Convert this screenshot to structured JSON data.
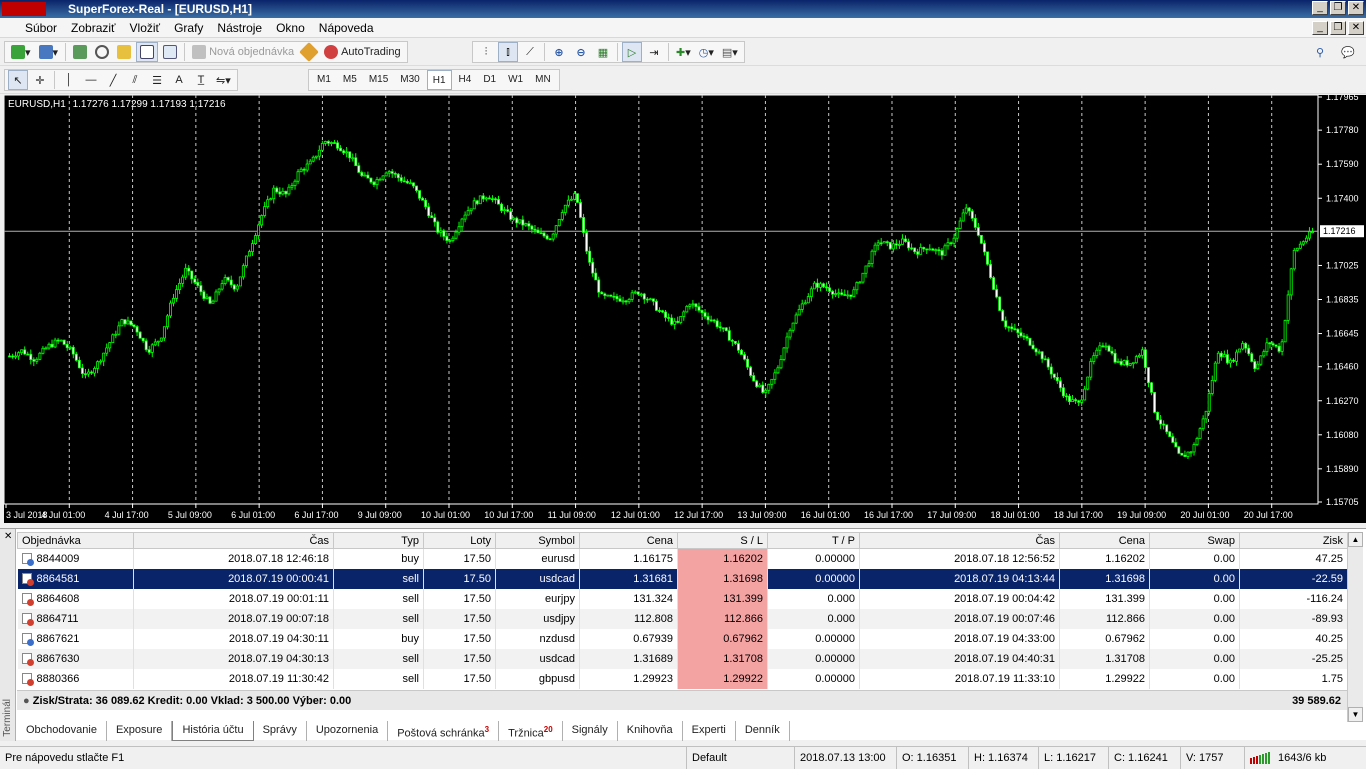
{
  "window": {
    "title": "SuperForex-Real - [EURUSD,H1]"
  },
  "menu": {
    "items": [
      "Súbor",
      "Zobraziť",
      "Vložiť",
      "Grafy",
      "Nástroje",
      "Okno",
      "Nápoveda"
    ]
  },
  "toolbar": {
    "new_order_label": "Nová objednávka",
    "autotrading_label": "AutoTrading"
  },
  "timeframes": {
    "items": [
      "M1",
      "M5",
      "M15",
      "M30",
      "H1",
      "H4",
      "D1",
      "W1",
      "MN"
    ],
    "active": "H1"
  },
  "chart_data": {
    "type": "candlestick",
    "title": "EURUSD,H1  1.17276 1.17299 1.17193 1.17216",
    "symbol": "EURUSD,H1",
    "ohlc_header": "1.17276 1.17299 1.17193 1.17216",
    "y_ticks": [
      "1.17965",
      "1.17780",
      "1.17590",
      "1.17400",
      "1.17216",
      "1.17025",
      "1.16835",
      "1.16645",
      "1.16460",
      "1.16270",
      "1.16080",
      "1.15890",
      "1.15705"
    ],
    "y_tick_values": [
      1.17965,
      1.1778,
      1.1759,
      1.174,
      1.17216,
      1.17025,
      1.16835,
      1.16645,
      1.1646,
      1.1627,
      1.1608,
      1.1589,
      1.15705
    ],
    "ylim": [
      1.15705,
      1.17965
    ],
    "current_price": 1.17216,
    "current_price_label": "1.17216",
    "x_ticks": [
      "3 Jul 2018",
      "4 Jul 01:00",
      "4 Jul 17:00",
      "5 Jul 09:00",
      "6 Jul 01:00",
      "6 Jul 17:00",
      "9 Jul 09:00",
      "10 Jul 01:00",
      "10 Jul 17:00",
      "11 Jul 09:00",
      "12 Jul 01:00",
      "12 Jul 17:00",
      "13 Jul 09:00",
      "16 Jul 01:00",
      "16 Jul 17:00",
      "17 Jul 09:00",
      "18 Jul 01:00",
      "18 Jul 17:00",
      "19 Jul 09:00",
      "20 Jul 01:00",
      "20 Jul 17:00"
    ],
    "close_path": [
      [
        0,
        1.1652
      ],
      [
        2,
        1.1655
      ],
      [
        4,
        1.165
      ],
      [
        6,
        1.1657
      ],
      [
        8,
        1.1661
      ],
      [
        10,
        1.1654
      ],
      [
        12,
        1.164
      ],
      [
        14,
        1.1648
      ],
      [
        16,
        1.166
      ],
      [
        18,
        1.1672
      ],
      [
        20,
        1.1668
      ],
      [
        22,
        1.1655
      ],
      [
        24,
        1.1662
      ],
      [
        26,
        1.1685
      ],
      [
        28,
        1.17
      ],
      [
        30,
        1.169
      ],
      [
        32,
        1.168
      ],
      [
        34,
        1.1695
      ],
      [
        36,
        1.169
      ],
      [
        38,
        1.171
      ],
      [
        40,
        1.173
      ],
      [
        42,
        1.1745
      ],
      [
        44,
        1.1742
      ],
      [
        46,
        1.1755
      ],
      [
        48,
        1.176
      ],
      [
        50,
        1.1772
      ],
      [
        52,
        1.177
      ],
      [
        54,
        1.1764
      ],
      [
        56,
        1.1752
      ],
      [
        58,
        1.1749
      ],
      [
        60,
        1.1756
      ],
      [
        62,
        1.1751
      ],
      [
        64,
        1.1747
      ],
      [
        66,
        1.1736
      ],
      [
        68,
        1.1722
      ],
      [
        70,
        1.1716
      ],
      [
        72,
        1.173
      ],
      [
        74,
        1.1738
      ],
      [
        76,
        1.1742
      ],
      [
        78,
        1.1735
      ],
      [
        80,
        1.1728
      ],
      [
        82,
        1.1725
      ],
      [
        84,
        1.172
      ],
      [
        86,
        1.1718
      ],
      [
        88,
        1.1735
      ],
      [
        90,
        1.1742
      ],
      [
        92,
        1.1705
      ],
      [
        94,
        1.1685
      ],
      [
        96,
        1.1684
      ],
      [
        98,
        1.1684
      ],
      [
        100,
        1.1688
      ],
      [
        102,
        1.1682
      ],
      [
        104,
        1.1674
      ],
      [
        106,
        1.1669
      ],
      [
        108,
        1.1682
      ],
      [
        110,
        1.1676
      ],
      [
        112,
        1.1671
      ],
      [
        114,
        1.1664
      ],
      [
        116,
        1.1655
      ],
      [
        118,
        1.164
      ],
      [
        120,
        1.163
      ],
      [
        122,
        1.1645
      ],
      [
        124,
        1.1668
      ],
      [
        126,
        1.1681
      ],
      [
        128,
        1.1692
      ],
      [
        130,
        1.169
      ],
      [
        132,
        1.1685
      ],
      [
        134,
        1.1687
      ],
      [
        136,
        1.1701
      ],
      [
        138,
        1.1716
      ],
      [
        140,
        1.1713
      ],
      [
        142,
        1.1716
      ],
      [
        144,
        1.171
      ],
      [
        146,
        1.1713
      ],
      [
        148,
        1.1709
      ],
      [
        150,
        1.1718
      ],
      [
        152,
        1.1735
      ],
      [
        154,
        1.172
      ],
      [
        156,
        1.1695
      ],
      [
        158,
        1.167
      ],
      [
        160,
        1.1665
      ],
      [
        162,
        1.166
      ],
      [
        164,
        1.1652
      ],
      [
        166,
        1.164
      ],
      [
        168,
        1.1628
      ],
      [
        170,
        1.1625
      ],
      [
        172,
        1.165
      ],
      [
        174,
        1.166
      ],
      [
        176,
        1.1648
      ],
      [
        178,
        1.1648
      ],
      [
        180,
        1.1655
      ],
      [
        182,
        1.162
      ],
      [
        184,
        1.1608
      ],
      [
        186,
        1.1595
      ],
      [
        188,
        1.16
      ],
      [
        190,
        1.162
      ],
      [
        192,
        1.1655
      ],
      [
        194,
        1.1648
      ],
      [
        196,
        1.166
      ],
      [
        198,
        1.1645
      ],
      [
        200,
        1.166
      ],
      [
        202,
        1.1655
      ],
      [
        204,
        1.171
      ],
      [
        206,
        1.1718
      ],
      [
        207,
        1.1721
      ]
    ],
    "grid": true
  },
  "terminal": {
    "side_label": "Terminál",
    "columns": [
      "Objednávka",
      "Čas",
      "Typ",
      "Loty",
      "Symbol",
      "Cena",
      "S / L",
      "T / P",
      "Čas",
      "Cena",
      "Swap",
      "Zisk"
    ],
    "rows": [
      {
        "order": "8844009",
        "open_time": "2018.07.18 12:46:18",
        "type": "buy",
        "lots": "17.50",
        "symbol": "eurusd",
        "price": "1.16175",
        "sl": "1.16202",
        "tp": "0.00000",
        "close_time": "2018.07.18 12:56:52",
        "close_price": "1.16202",
        "swap": "0.00",
        "profit": "47.25"
      },
      {
        "order": "8864581",
        "open_time": "2018.07.19 00:00:41",
        "type": "sell",
        "lots": "17.50",
        "symbol": "usdcad",
        "price": "1.31681",
        "sl": "1.31698",
        "tp": "0.00000",
        "close_time": "2018.07.19 04:13:44",
        "close_price": "1.31698",
        "swap": "0.00",
        "profit": "-22.59"
      },
      {
        "order": "8864608",
        "open_time": "2018.07.19 00:01:11",
        "type": "sell",
        "lots": "17.50",
        "symbol": "eurjpy",
        "price": "131.324",
        "sl": "131.399",
        "tp": "0.000",
        "close_time": "2018.07.19 00:04:42",
        "close_price": "131.399",
        "swap": "0.00",
        "profit": "-116.24"
      },
      {
        "order": "8864711",
        "open_time": "2018.07.19 00:07:18",
        "type": "sell",
        "lots": "17.50",
        "symbol": "usdjpy",
        "price": "112.808",
        "sl": "112.866",
        "tp": "0.000",
        "close_time": "2018.07.19 00:07:46",
        "close_price": "112.866",
        "swap": "0.00",
        "profit": "-89.93"
      },
      {
        "order": "8867621",
        "open_time": "2018.07.19 04:30:11",
        "type": "buy",
        "lots": "17.50",
        "symbol": "nzdusd",
        "price": "0.67939",
        "sl": "0.67962",
        "tp": "0.00000",
        "close_time": "2018.07.19 04:33:00",
        "close_price": "0.67962",
        "swap": "0.00",
        "profit": "40.25"
      },
      {
        "order": "8867630",
        "open_time": "2018.07.19 04:30:13",
        "type": "sell",
        "lots": "17.50",
        "symbol": "usdcad",
        "price": "1.31689",
        "sl": "1.31708",
        "tp": "0.00000",
        "close_time": "2018.07.19 04:40:31",
        "close_price": "1.31708",
        "swap": "0.00",
        "profit": "-25.25"
      },
      {
        "order": "8880366",
        "open_time": "2018.07.19 11:30:42",
        "type": "sell",
        "lots": "17.50",
        "symbol": "gbpusd",
        "price": "1.29923",
        "sl": "1.29922",
        "tp": "0.00000",
        "close_time": "2018.07.19 11:33:10",
        "close_price": "1.29922",
        "swap": "0.00",
        "profit": "1.75"
      }
    ],
    "selected_row": 1,
    "summary": "Zisk/Strata: 36 089.62  Kredit: 0.00  Vklad: 3 500.00  Výber: 0.00",
    "total": "39 589.62",
    "tabs": [
      {
        "label": "Obchodovanie",
        "badge": ""
      },
      {
        "label": "Exposure",
        "badge": ""
      },
      {
        "label": "História účtu",
        "badge": ""
      },
      {
        "label": "Správy",
        "badge": ""
      },
      {
        "label": "Upozornenia",
        "badge": ""
      },
      {
        "label": "Poštová schránka",
        "badge": "3"
      },
      {
        "label": "Tržnica",
        "badge": "20"
      },
      {
        "label": "Signály",
        "badge": ""
      },
      {
        "label": "Knihovňa",
        "badge": ""
      },
      {
        "label": "Experti",
        "badge": ""
      },
      {
        "label": "Denník",
        "badge": ""
      }
    ],
    "active_tab": 2
  },
  "status": {
    "help": "Pre nápovedu stlačte F1",
    "profile": "Default",
    "time": "2018.07.13 13:00",
    "open": "O: 1.16351",
    "high": "H: 1.16374",
    "low": "L: 1.16217",
    "close": "C: 1.16241",
    "volume": "V: 1757",
    "traffic": "1643/6 kb"
  },
  "colors": {
    "bull": "#00ff00",
    "bear": "#00ff00",
    "chart_bg": "#000000",
    "sl_cell": "#f4a3a3",
    "selection": "#0a246a"
  }
}
